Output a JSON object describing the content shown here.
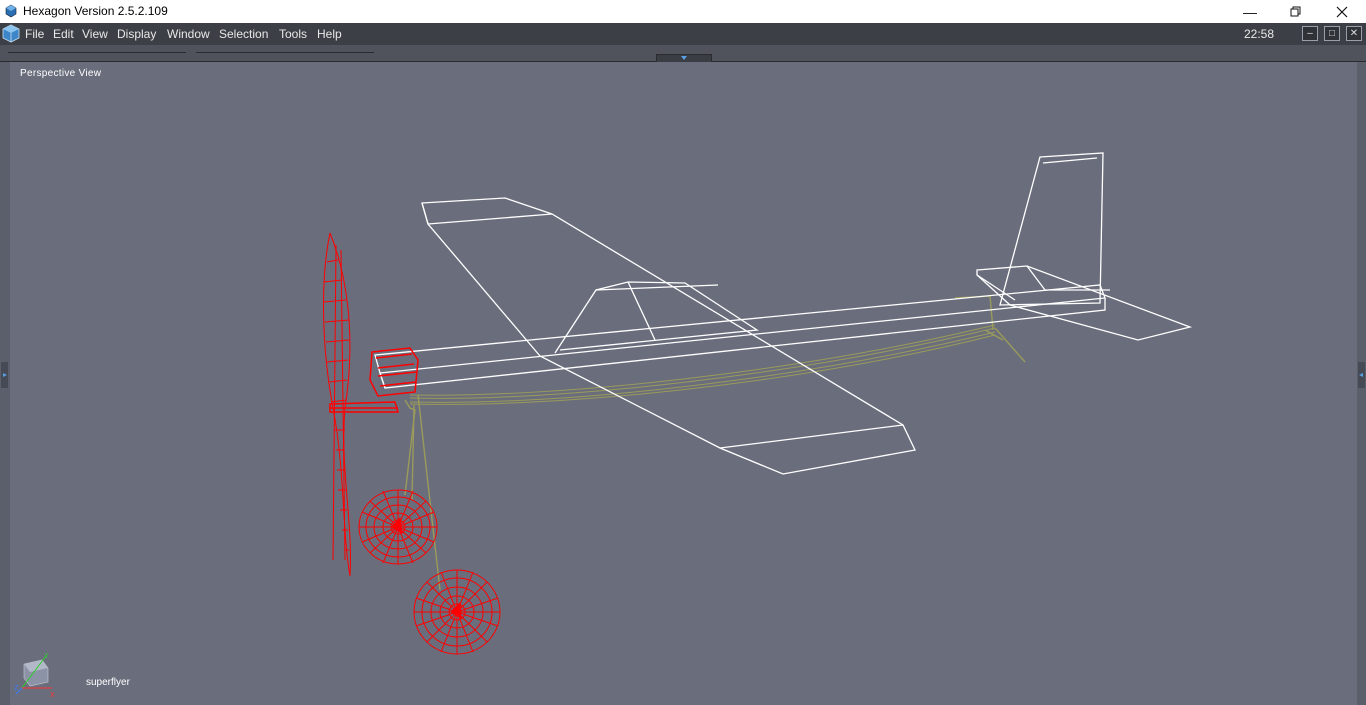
{
  "window": {
    "title": "Hexagon Version 2.5.2.109",
    "controls": [
      "minimize",
      "restore",
      "close"
    ]
  },
  "menubar": {
    "items": [
      "File",
      "Edit",
      "View",
      "Display",
      "Window",
      "Selection",
      "Tools",
      "Help"
    ],
    "clock": "22:58"
  },
  "viewport": {
    "label": "Perspective View",
    "object_name": "superflyer",
    "gizmo_axes": [
      "Y",
      "Z",
      "X"
    ]
  },
  "colors": {
    "viewport_bg": "#6a6e7c",
    "wireframe_white": "#ffffff",
    "wireframe_red": "#ff0000",
    "wireframe_olive": "#9a9a5a"
  }
}
